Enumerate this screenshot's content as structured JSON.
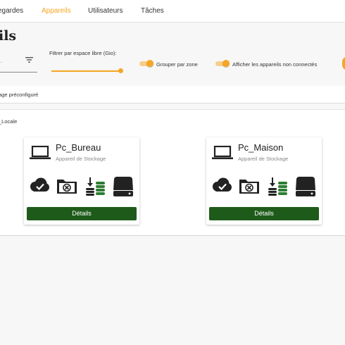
{
  "nav": {
    "items": [
      {
        "label": "egardes",
        "active": false
      },
      {
        "label": "Appareils",
        "active": true
      },
      {
        "label": "Utilisateurs",
        "active": false
      },
      {
        "label": "Tâches",
        "active": false
      }
    ],
    "active_color": "#f5a623"
  },
  "page": {
    "title": "ils"
  },
  "filters": {
    "search_placeholder": "...",
    "free_space_label": "Filtrer par espace libre (Gio):",
    "free_space_value_fraction": 1.0,
    "group_by_zone": {
      "label": "Grouper par zone",
      "checked": true
    },
    "show_disconnected": {
      "label": "Afficher les appareils non connectés",
      "checked": true
    }
  },
  "config_bar": {
    "label": "age préconfiguré"
  },
  "zone": {
    "label": "_Locale",
    "devices": [
      {
        "name": "Pc_Bureau",
        "type": "Appareil de Stockage",
        "details_label": "Détails"
      },
      {
        "name": "Pc_Maison",
        "type": "Appareil de Stockage",
        "details_label": "Détails"
      }
    ]
  },
  "icons": [
    "filter-icon",
    "laptop-icon",
    "cloud-check-icon",
    "folder-cancel-icon",
    "storage-level-icon",
    "hard-drive-icon"
  ],
  "colors": {
    "accent": "#f5a623",
    "details_button": "#1e5b1a",
    "storage_green": "#2e7d32"
  }
}
